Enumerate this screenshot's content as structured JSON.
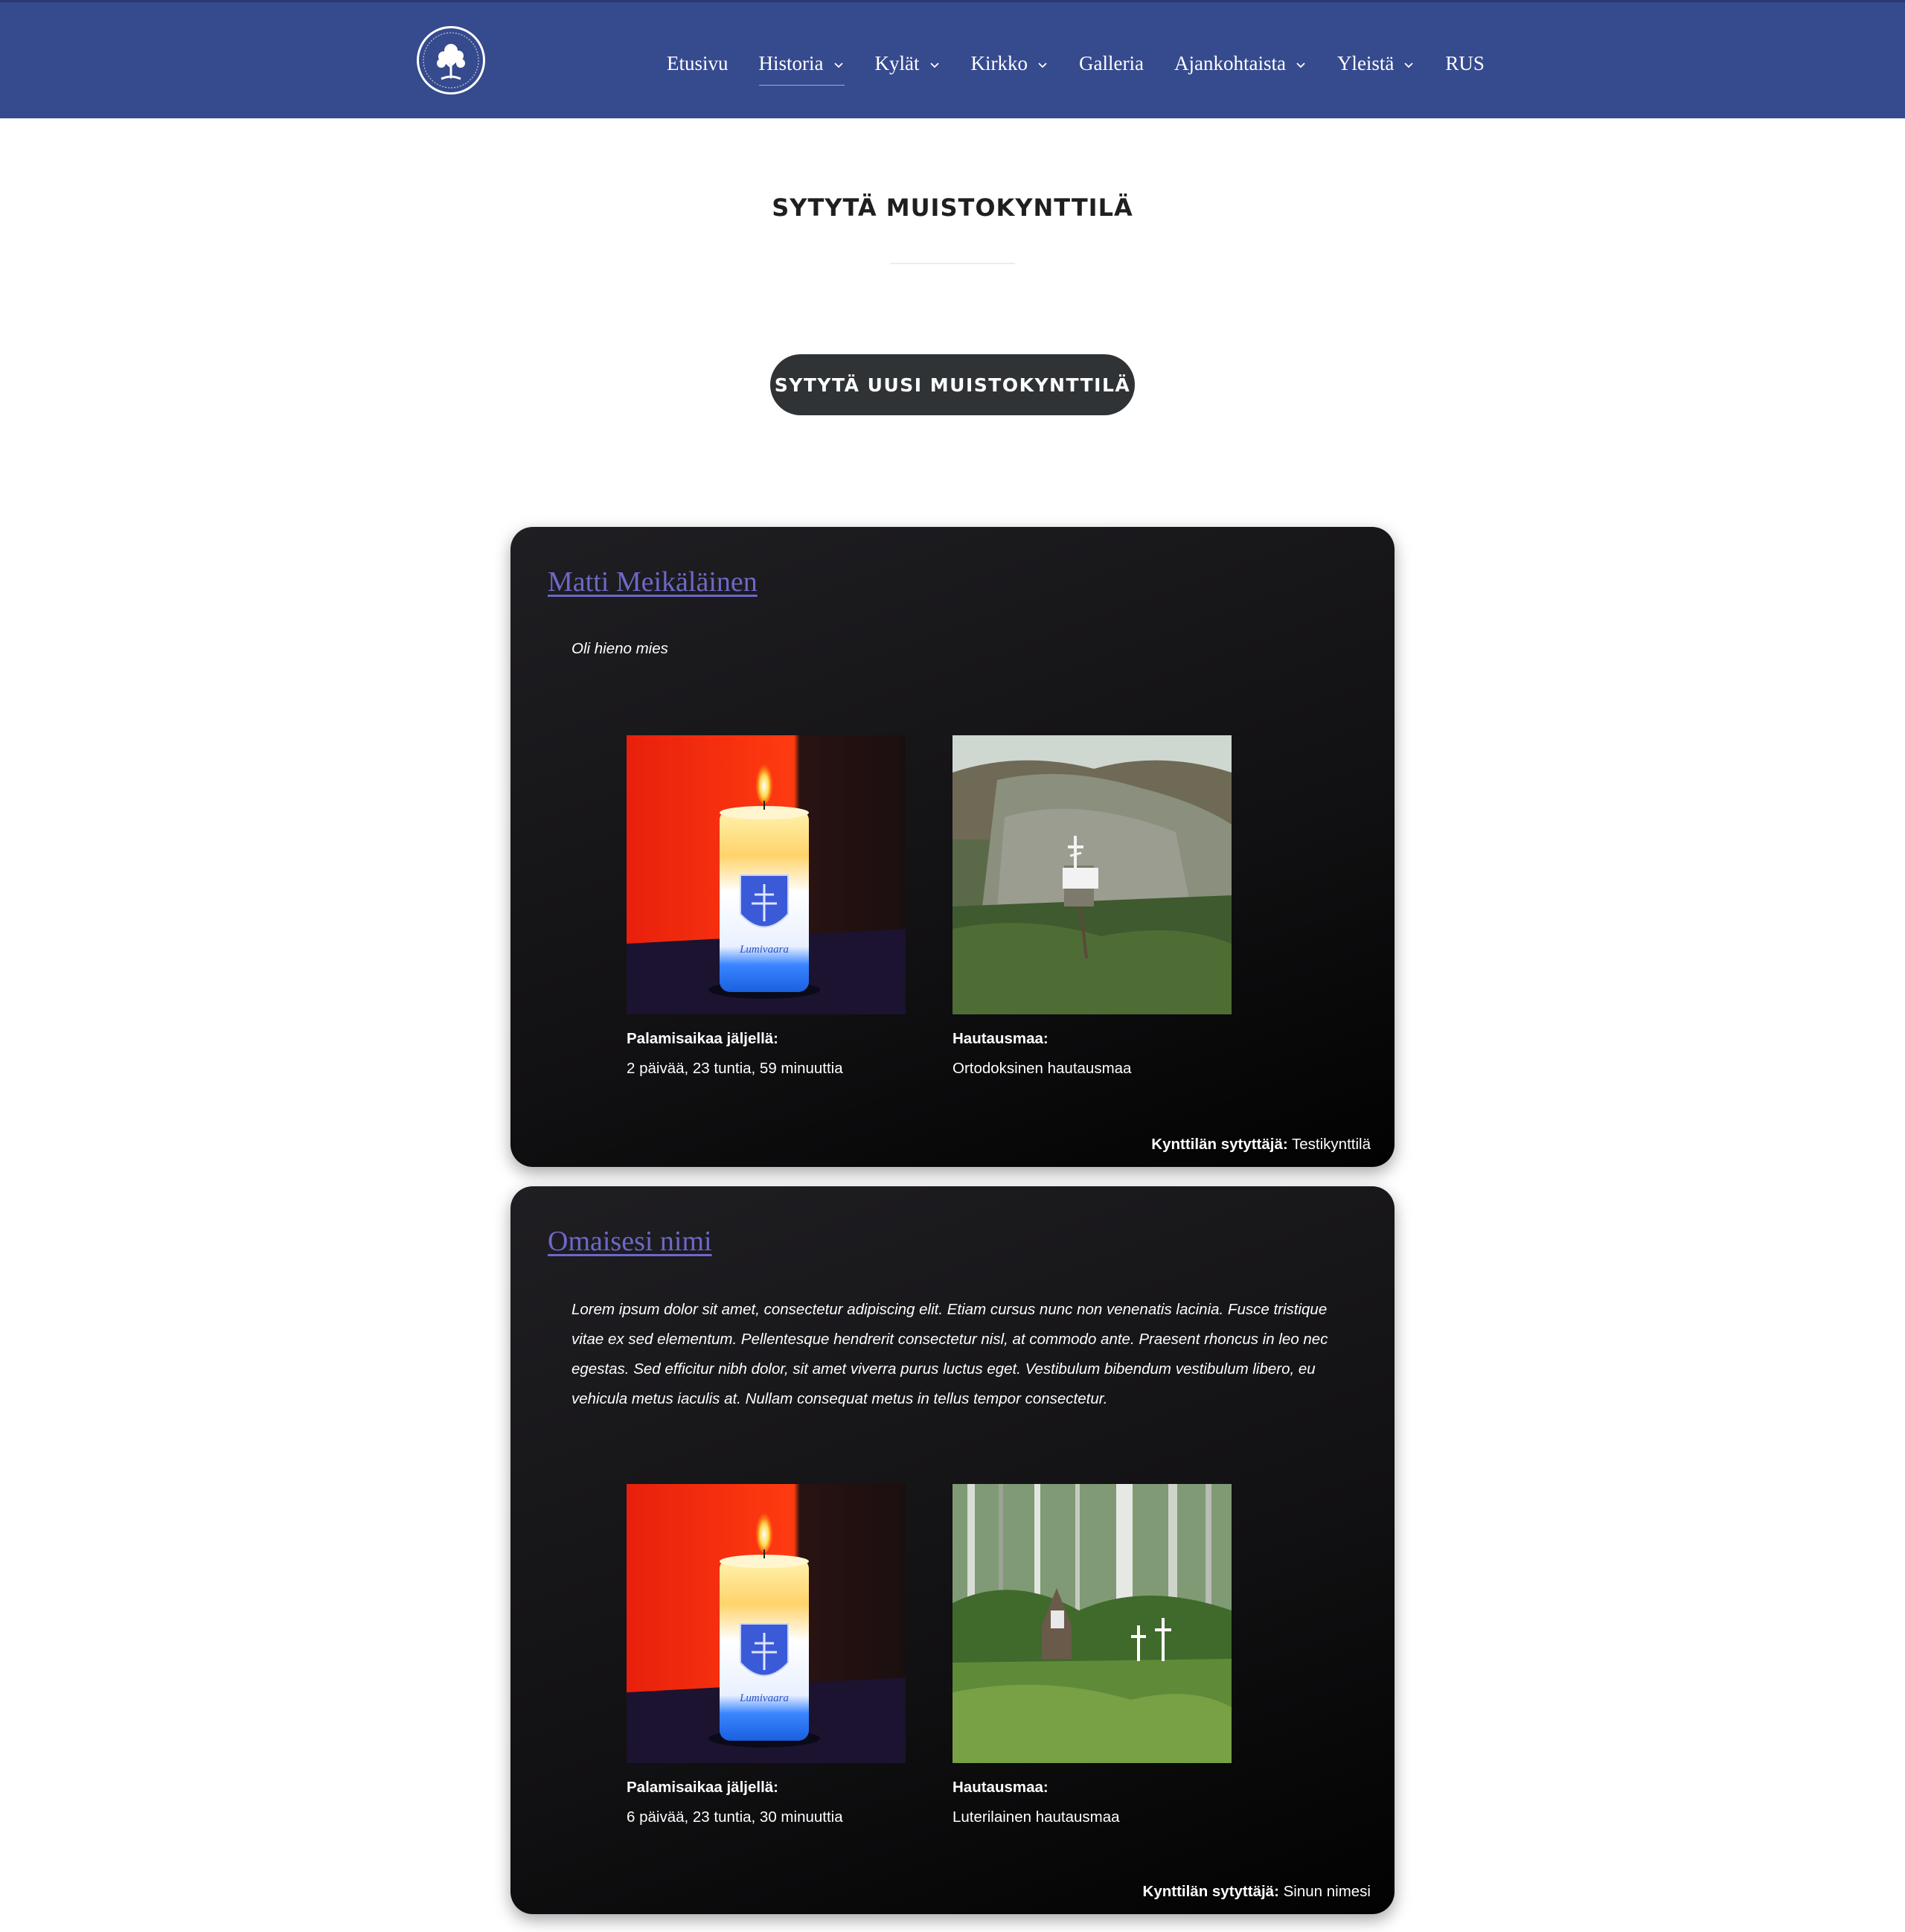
{
  "header": {
    "logo_icon": "tree-emblem-icon",
    "nav": [
      {
        "label": "Etusivu",
        "dropdown": false,
        "active": false
      },
      {
        "label": "Historia",
        "dropdown": true,
        "active": true
      },
      {
        "label": "Kylät",
        "dropdown": true,
        "active": false
      },
      {
        "label": "Kirkko",
        "dropdown": true,
        "active": false
      },
      {
        "label": "Galleria",
        "dropdown": false,
        "active": false
      },
      {
        "label": "Ajankohtaista",
        "dropdown": true,
        "active": false
      },
      {
        "label": "Yleistä",
        "dropdown": true,
        "active": false
      },
      {
        "label": "RUS",
        "dropdown": false,
        "active": false
      }
    ]
  },
  "page": {
    "title": "SYTYTÄ MUISTOKYNTTILÄ",
    "cta_label": "SYTYTÄ UUSI MUISTOKYNTTILÄ"
  },
  "candles": [
    {
      "name": "Matti Meikäläinen",
      "description": "Oli hieno mies",
      "burn_label": "Palamisaikaa jäljellä:",
      "burn_value": "2 päivää, 23 tuntia, 59 minuuttia",
      "cemetery_label": "Hautausmaa:",
      "cemetery_value": "Ortodoksinen hautausmaa",
      "lighter_label": "Kynttilän sytyttäjä:",
      "lighter_value": "Testikynttilä",
      "candle_text": "Lumivaara"
    },
    {
      "name": "Omaisesi nimi",
      "description": "Lorem ipsum dolor sit amet, consectetur adipiscing elit. Etiam cursus nunc non venenatis lacinia. Fusce tristique vitae ex sed elementum. Pellentesque hendrerit consectetur nisl, at commodo ante. Praesent rhoncus in leo nec egestas. Sed efficitur nibh dolor, sit amet viverra purus luctus eget. Vestibulum bibendum vestibulum libero, eu vehicula metus iaculis at. Nullam consequat metus in tellus tempor consectetur.",
      "burn_label": "Palamisaikaa jäljellä:",
      "burn_value": "6 päivää, 23 tuntia, 30 minuuttia",
      "cemetery_label": "Hautausmaa:",
      "cemetery_value": "Luterilainen hautausmaa",
      "lighter_label": "Kynttilän sytyttäjä:",
      "lighter_value": "Sinun nimesi",
      "candle_text": "Lumivaara"
    }
  ],
  "colors": {
    "header_bg": "#364a8e",
    "link": "#6d68c7",
    "button_bg": "#2f3336",
    "card_bg": "#141316"
  }
}
